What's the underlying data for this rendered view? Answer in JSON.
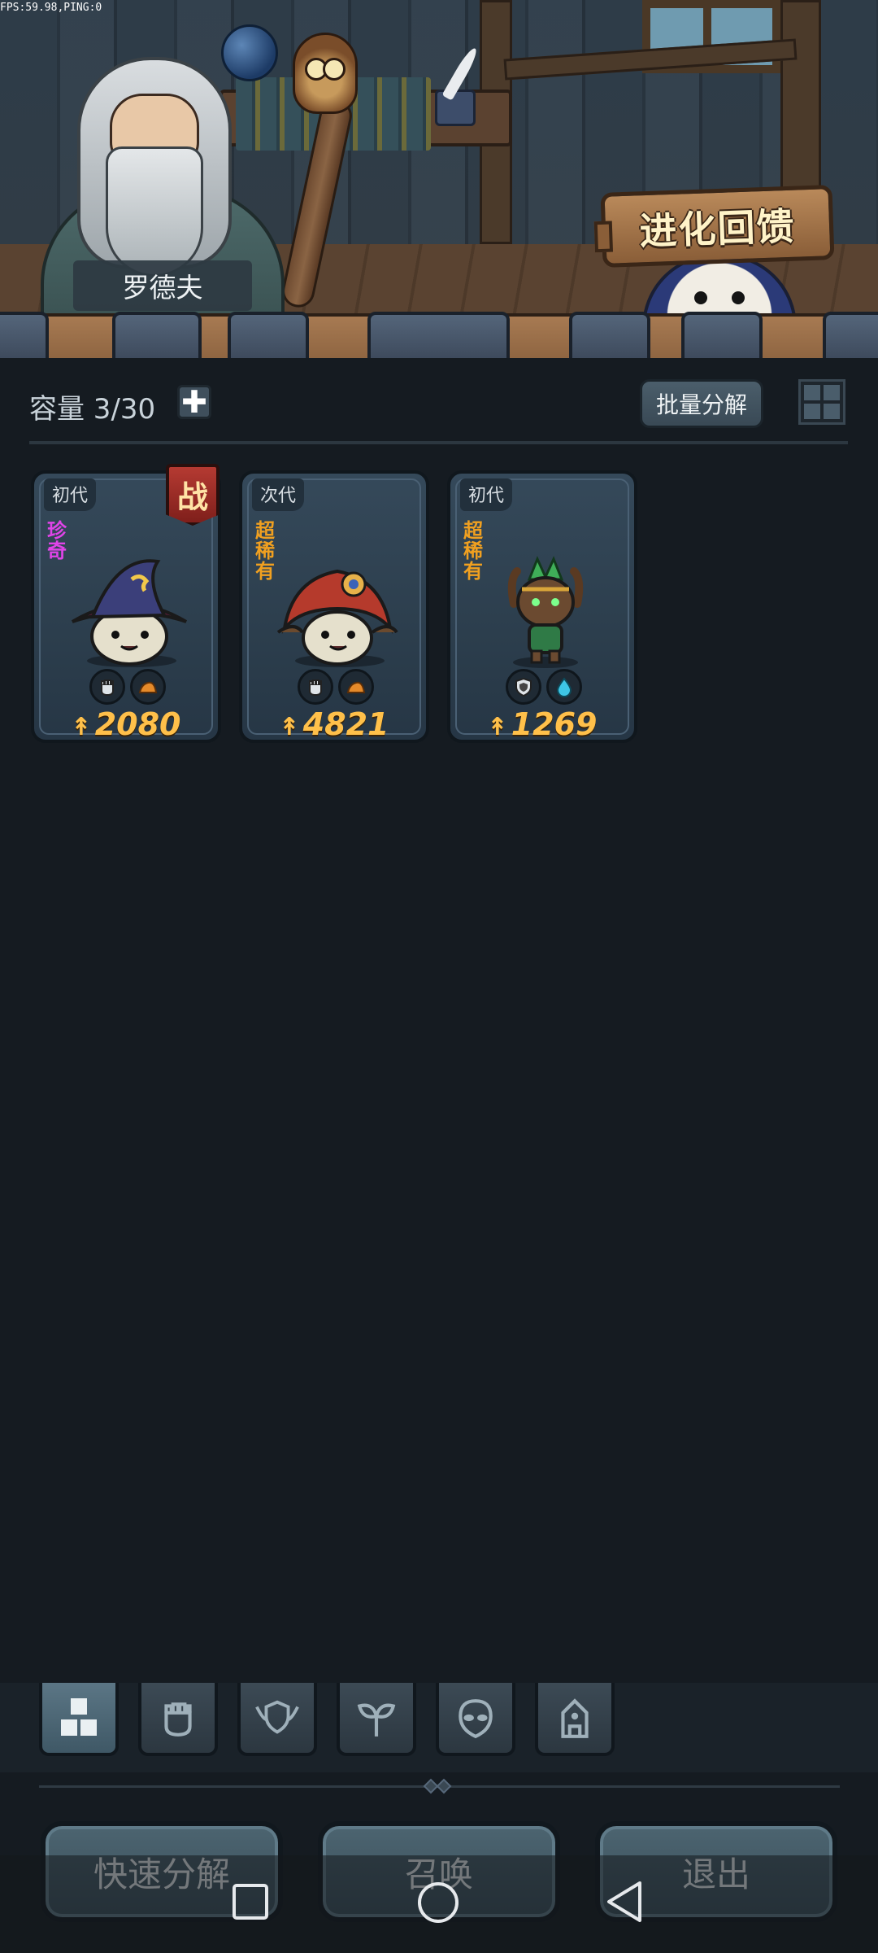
{
  "debug": {
    "fps_text": "FPS:59.98,PING:0"
  },
  "scene": {
    "npc_name": "罗德夫",
    "evolution_sign": "进化回馈"
  },
  "inventory": {
    "capacity_label": "容量 3/30",
    "add_symbol": "✚",
    "batch_decompose_label": "批量分解"
  },
  "cards": [
    {
      "generation": "初代",
      "rarity": "珍奇",
      "rarity_color": "#e044e8",
      "in_battle": true,
      "battle_label": "战",
      "attributes": [
        "fist-icon",
        "earth-icon"
      ],
      "power": "2080"
    },
    {
      "generation": "次代",
      "rarity": "超稀有",
      "rarity_color": "#f0a020",
      "in_battle": false,
      "attributes": [
        "fist-icon",
        "earth-icon"
      ],
      "power": "4821"
    },
    {
      "generation": "初代",
      "rarity": "超稀有",
      "rarity_color": "#f0a020",
      "in_battle": false,
      "attributes": [
        "shield-icon",
        "water-icon"
      ],
      "power": "1269"
    }
  ],
  "filter_tabs": [
    "all-icon",
    "fist-icon",
    "shield-wings-icon",
    "sprout-icon",
    "alien-head-icon",
    "tower-icon"
  ],
  "actions": {
    "quick_decompose": "快速分解",
    "summon": "召唤",
    "exit": "退出"
  },
  "colors": {
    "power": "#ffc04a",
    "epic": "#e044e8",
    "legendary": "#f0a020"
  }
}
